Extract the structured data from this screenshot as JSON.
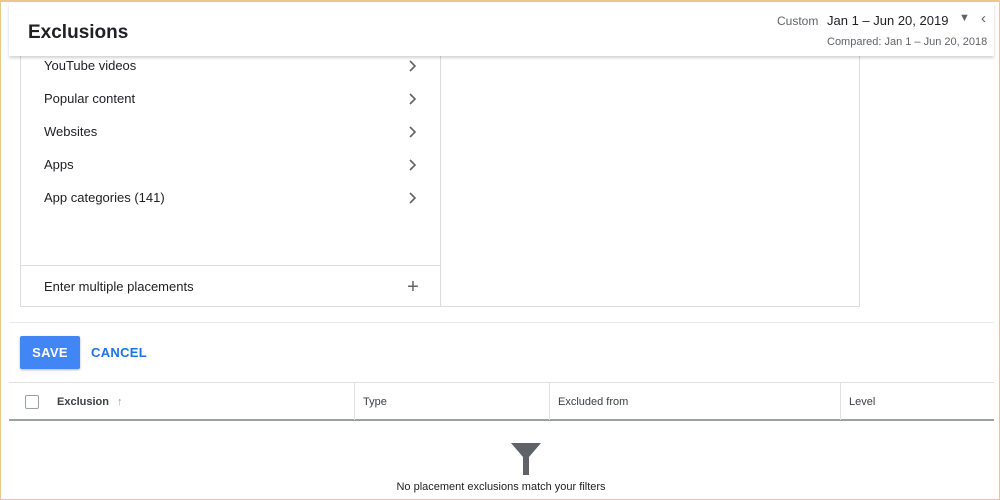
{
  "header": {
    "title": "Exclusions",
    "date_mode": "Custom",
    "date_range": "Jan 1 – Jun 20, 2019",
    "compared": "Compared: Jan 1 – Jun 20, 2018"
  },
  "placement_nav": {
    "items": [
      {
        "label": "YouTube videos",
        "icon": "chevron-right-icon"
      },
      {
        "label": "Popular content",
        "icon": "chevron-right-icon"
      },
      {
        "label": "Websites",
        "icon": "chevron-right-icon"
      },
      {
        "label": "Apps",
        "icon": "chevron-right-icon"
      },
      {
        "label": "App categories (141)",
        "icon": "chevron-right-icon"
      }
    ],
    "multi_label": "Enter multiple placements",
    "multi_icon": "plus-icon"
  },
  "actions": {
    "save_label": "SAVE",
    "cancel_label": "CANCEL"
  },
  "table": {
    "columns": [
      "Exclusion",
      "Type",
      "Excluded from",
      "Level"
    ],
    "sort_icon": "arrow-up-icon",
    "empty_message": "No placement exclusions match your filters",
    "empty_icon": "filter-icon"
  },
  "colors": {
    "accent": "#4285f4",
    "link": "#1a73e8",
    "frame": "#e8c98a"
  }
}
